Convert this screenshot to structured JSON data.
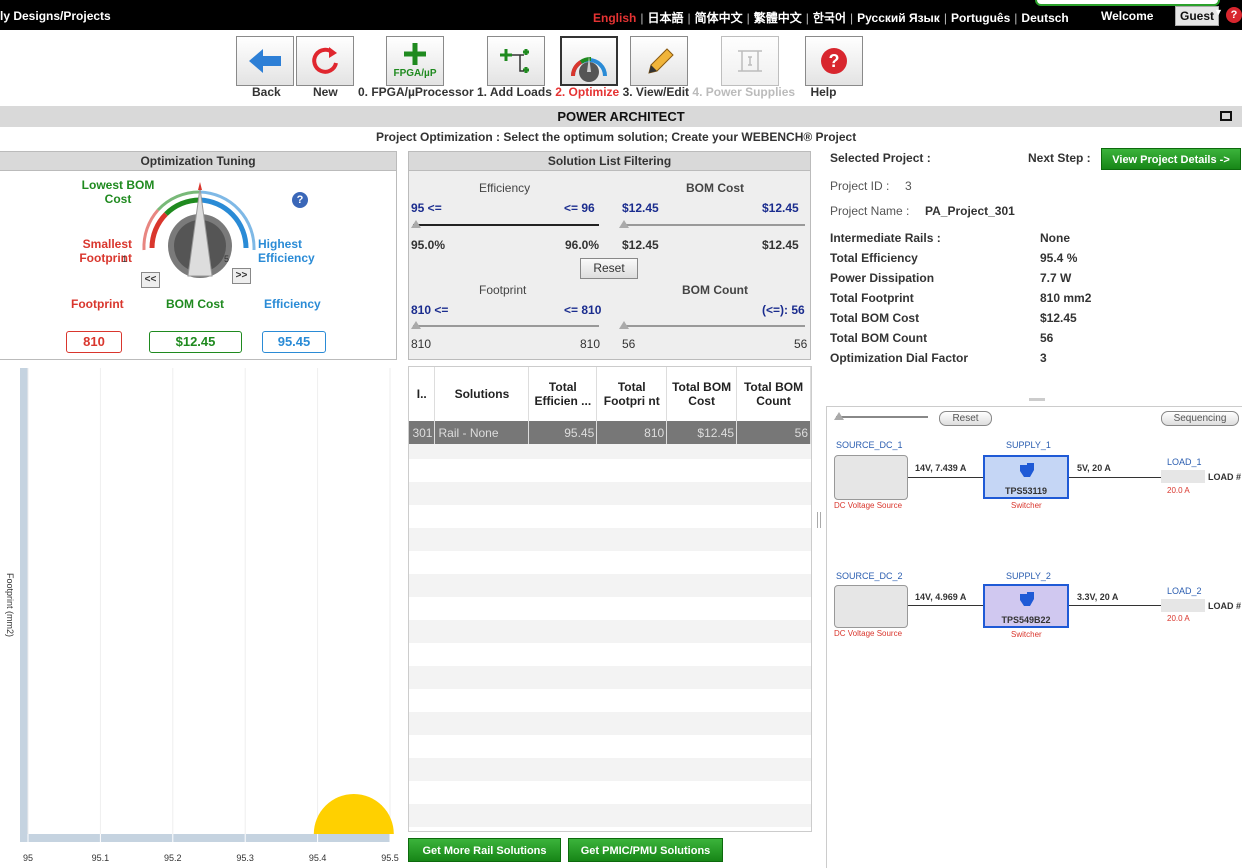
{
  "topbar": {
    "my_designs": "ly Designs/Projects",
    "languages": [
      {
        "label": "English",
        "active": true
      },
      {
        "label": "日本語",
        "active": false
      },
      {
        "label": "简体中文",
        "active": false
      },
      {
        "label": "繁體中文",
        "active": false
      },
      {
        "label": "한국어",
        "active": false
      },
      {
        "label": "Русский Язык",
        "active": false
      },
      {
        "label": "Português",
        "active": false
      },
      {
        "label": "Deutsch",
        "active": false
      }
    ],
    "welcome": "Welcome",
    "user": "Guest",
    "help_mark": "?"
  },
  "toolbar": {
    "back": "Back",
    "new": "New",
    "fpga_icon_text": "FPGA/µP",
    "steps": {
      "s0": "0. FPGA/µProcessor",
      "s1": "1. Add Loads",
      "s2": "2. Optimize",
      "s3": "3. View/Edit",
      "s4": "4. Power Supplies"
    },
    "help": "Help"
  },
  "title": "POWER ARCHITECT",
  "subtitle": "Project Optimization : Select the optimum solution; Create your WEBENCH® Project",
  "tuning": {
    "header": "Optimization Tuning",
    "lowest_bom_cost": "Lowest BOM Cost",
    "smallest_footprint": "Smallest Footprint",
    "highest_efficiency": "Highest Efficiency",
    "dial_min": "1",
    "dial_max": "5",
    "prev": "<<",
    "next": ">>",
    "footprint_label": "Footprint",
    "bom_cost_label": "BOM Cost",
    "efficiency_label": "Efficiency",
    "footprint_value": "810",
    "bom_cost_value": "$12.45",
    "efficiency_value": "95.45",
    "help_mark": "?",
    "colors": {
      "bom": "#1f8a1f",
      "footprint": "#d9362d",
      "efficiency": "#2a8bd6"
    }
  },
  "filtering": {
    "header": "Solution List Filtering",
    "efficiency": {
      "title": "Efficiency",
      "min_label": "95 <=",
      "max_label": "<= 96",
      "low": "95.0%",
      "high": "96.0%"
    },
    "bom_cost": {
      "title": "BOM Cost",
      "min_label": "$12.45",
      "max_label": "$12.45",
      "low": "$12.45",
      "high": "$12.45"
    },
    "reset": "Reset",
    "footprint": {
      "title": "Footprint",
      "min_label": "810 <=",
      "max_label": "<= 810",
      "low": "810",
      "high": "810"
    },
    "bom_count": {
      "title": "BOM Count",
      "max_label": "(<=): 56",
      "low": "56",
      "high": "56"
    }
  },
  "solutions_table": {
    "headers": [
      "I..",
      "Solutions",
      "Total Efficien ...",
      "Total Footpri nt",
      "Total BOM Cost",
      "Total BOM Count"
    ],
    "rows": [
      {
        "id": "301",
        "solution": "Rail - None",
        "efficiency": "95.45",
        "footprint": "810",
        "cost": "$12.45",
        "count": "56"
      }
    ]
  },
  "buttons": {
    "more_rail": "Get More Rail Solutions",
    "pmic": "Get PMIC/PMU Solutions"
  },
  "chart": {
    "y_label": "Footprint (mm2)",
    "x_ticks": [
      "95",
      "95.1",
      "95.2",
      "95.3",
      "95.4",
      "95.5"
    ]
  },
  "chart_data": {
    "type": "scatter",
    "title": "",
    "xlabel": "",
    "ylabel": "Footprint (mm2)",
    "xlim": [
      95,
      95.5
    ],
    "x": [
      95.45
    ],
    "y": [
      810
    ],
    "point_color": "#ffd000"
  },
  "project": {
    "selected_label": "Selected Project :",
    "next_step_label": "Next Step :",
    "view_details": "View Project Details ->",
    "project_id_label": "Project ID :",
    "project_id": "3",
    "project_name_label": "Project Name :",
    "project_name": "PA_Project_301",
    "details": [
      {
        "label": "Intermediate Rails :",
        "value": "None"
      },
      {
        "label": "Total Efficiency",
        "value": "95.4 %"
      },
      {
        "label": "Power Dissipation",
        "value": "7.7 W"
      },
      {
        "label": "Total Footprint",
        "value": "810 mm2"
      },
      {
        "label": "Total BOM Cost",
        "value": "$12.45"
      },
      {
        "label": "Total BOM Count",
        "value": "56"
      },
      {
        "label": "Optimization Dial Factor",
        "value": "3"
      }
    ]
  },
  "schematic": {
    "reset": "Reset",
    "sequencing": "Sequencing",
    "rails": [
      {
        "source": "SOURCE_DC_1",
        "source_type": "DC Voltage Source",
        "in_label": "14V, 7.439 A",
        "supply": "SUPPLY_1",
        "part": "TPS53119",
        "supply_type": "Switcher",
        "out_label": "5V, 20 A",
        "load": "LOAD_1",
        "load_name": "LOAD #",
        "load_current": "20.0 A"
      },
      {
        "source": "SOURCE_DC_2",
        "source_type": "DC Voltage Source",
        "in_label": "14V, 4.969 A",
        "supply": "SUPPLY_2",
        "part": "TPS549B22",
        "supply_type": "Switcher",
        "out_label": "3.3V, 20 A",
        "load": "LOAD_2",
        "load_name": "LOAD #",
        "load_current": "20.0 A"
      }
    ]
  }
}
